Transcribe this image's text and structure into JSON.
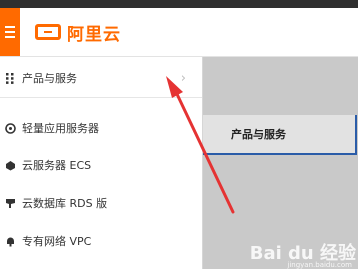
{
  "header": {
    "brand": "阿里云",
    "menu_icon": "hamburger-menu-icon"
  },
  "sidebar": {
    "items": [
      {
        "label": "产品与服务",
        "icon": "grid-icon",
        "active": true
      },
      {
        "label": "轻量应用服务器",
        "icon": "server-icon"
      },
      {
        "label": "云服务器 ECS",
        "icon": "cloud-icon"
      },
      {
        "label": "云数据库 RDS 版",
        "icon": "database-icon"
      },
      {
        "label": "专有网络 VPC",
        "icon": "network-icon"
      }
    ]
  },
  "content": {
    "tab_label": "产品与服务"
  },
  "colors": {
    "accent": "#ff6a00",
    "annotation": "#e53333",
    "tab_border": "#2a5ca8"
  },
  "watermark": {
    "text": "Bai du 经验",
    "sub": "jingyan.baidu.com"
  }
}
